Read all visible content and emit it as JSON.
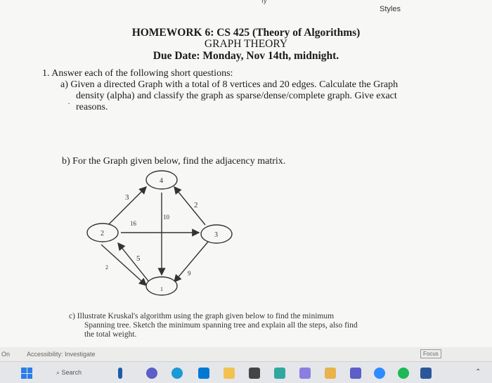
{
  "header": {
    "styles_label": "Styles",
    "top_mark": "Iy"
  },
  "title": {
    "line1": "HOMEWORK 6: CS 425 (Theory of Algorithms)",
    "line2": "GRAPH THEORY",
    "line3": "Due Date: Monday, Nov 14th, midnight."
  },
  "question1": {
    "intro": "1.  Answer each of the following short questions:",
    "a_line1": "a)  Given a directed Graph with a total of 8 vertices and 20 edges. Calculate the Graph",
    "a_line2": "density (alpha) and classify the graph as sparse/dense/complete graph. Give exact",
    "a_line3": "reasons.",
    "b_text": "b)  For the Graph given below, find the adjacency matrix.",
    "c_line1": "c)  Illustrate Kruskal's algorithm using the graph given below to find the minimum",
    "c_line2": "Spanning tree. Sketch the minimum spanning tree and explain all the steps, also find",
    "c_line3": "the total weight."
  },
  "graph": {
    "nodes": [
      "4",
      "2",
      "3",
      "1"
    ],
    "edge_weights": [
      "3",
      "2",
      "16",
      "10",
      "5",
      "9",
      "2"
    ]
  },
  "status_bar": {
    "left_text": "On",
    "accessibility": "Accessibility: Investigate",
    "focus": "Focus"
  },
  "taskbar": {
    "search_label": "Search"
  }
}
